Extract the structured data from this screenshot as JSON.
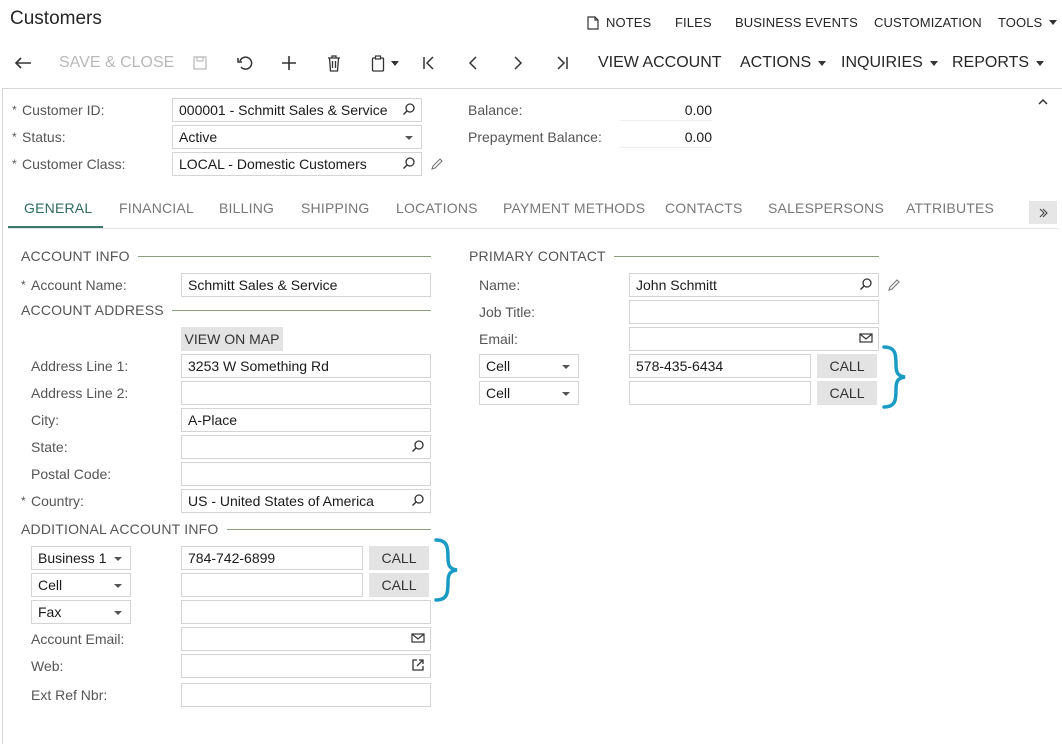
{
  "title": "Customers",
  "top_links": {
    "notes": "NOTES",
    "files": "FILES",
    "business_events": "BUSINESS EVENTS",
    "customization": "CUSTOMIZATION",
    "tools": "TOOLS"
  },
  "toolbar": {
    "save_close": "SAVE & CLOSE",
    "view_account": "VIEW ACCOUNT",
    "actions": "ACTIONS",
    "inquiries": "INQUIRIES",
    "reports": "REPORTS"
  },
  "summary": {
    "customer_id_label": "Customer ID:",
    "customer_id": "000001 - Schmitt Sales & Service",
    "status_label": "Status:",
    "status": "Active",
    "class_label": "Customer Class:",
    "class": "LOCAL - Domestic Customers",
    "balance_label": "Balance:",
    "balance": "0.00",
    "prepayment_label": "Prepayment Balance:",
    "prepayment": "0.00"
  },
  "tabs": [
    "GENERAL",
    "FINANCIAL",
    "BILLING",
    "SHIPPING",
    "LOCATIONS",
    "PAYMENT METHODS",
    "CONTACTS",
    "SALESPERSONS",
    "ATTRIBUTES"
  ],
  "account": {
    "section_info": "ACCOUNT INFO",
    "account_name_label": "Account Name:",
    "account_name": "Schmitt Sales & Service",
    "section_address": "ACCOUNT ADDRESS",
    "view_on_map": "VIEW ON MAP",
    "addr1_label": "Address Line 1:",
    "addr1": "3253 W Something Rd",
    "addr2_label": "Address Line 2:",
    "addr2": "",
    "city_label": "City:",
    "city": "A-Place",
    "state_label": "State:",
    "state": "",
    "postal_label": "Postal Code:",
    "postal": "",
    "country_label": "Country:",
    "country": "US - United States of America",
    "section_additional": "ADDITIONAL ACCOUNT INFO",
    "phone1_type": "Business 1",
    "phone1": "784-742-6899",
    "phone2_type": "Cell",
    "phone2": "",
    "fax_type": "Fax",
    "fax": "",
    "email_label": "Account Email:",
    "email": "",
    "web_label": "Web:",
    "web": "",
    "extref_label": "Ext Ref Nbr:",
    "extref": "",
    "call": "CALL"
  },
  "contact": {
    "section": "PRIMARY CONTACT",
    "name_label": "Name:",
    "name": "John Schmitt",
    "job_label": "Job Title:",
    "job": "",
    "email_label": "Email:",
    "email": "",
    "phone1_type": "Cell",
    "phone1": "578-435-6434",
    "phone2_type": "Cell",
    "phone2": "",
    "call": "CALL"
  },
  "colors": {
    "accent": "#3b7a6a",
    "bracket": "#1a9bc4"
  }
}
